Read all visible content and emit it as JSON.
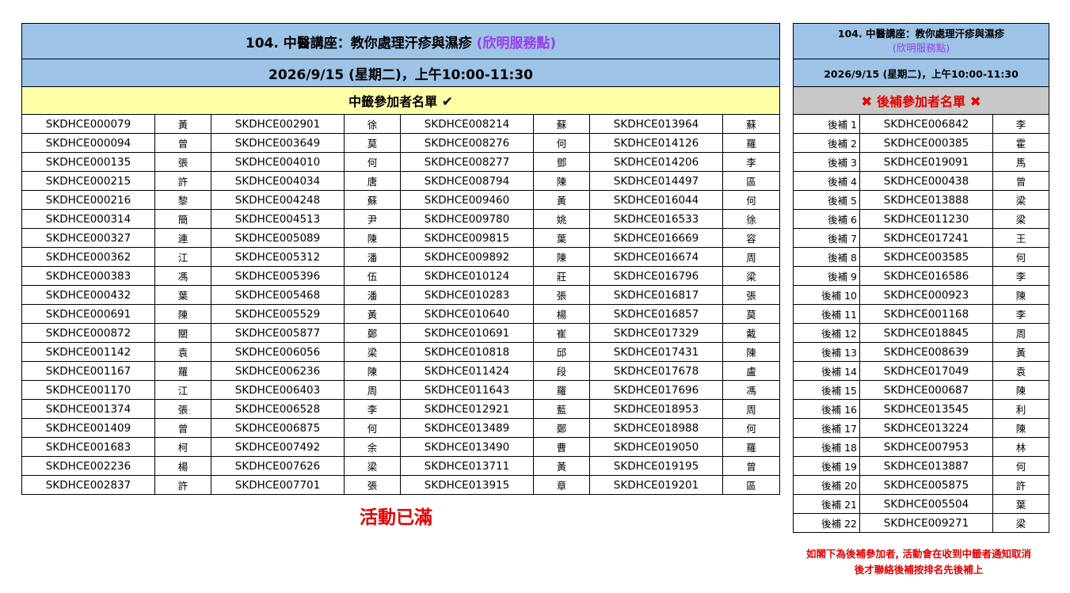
{
  "main": {
    "title_text": "104. 中醫講座：教你處理汗疹與濕疹 ",
    "title_location": "(欣明服務點)",
    "date": "2026/9/15 (星期二)，上午10:00-11:30",
    "selected_header": "中籤參加者名單",
    "check_glyph": "✔",
    "rows": [
      [
        "SKDHCE000079",
        "黃",
        "SKDHCE002901",
        "徐",
        "SKDHCE008214",
        "蘇",
        "SKDHCE013964",
        "蘇"
      ],
      [
        "SKDHCE000094",
        "曾",
        "SKDHCE003649",
        "莫",
        "SKDHCE008276",
        "何",
        "SKDHCE014126",
        "羅"
      ],
      [
        "SKDHCE000135",
        "張",
        "SKDHCE004010",
        "何",
        "SKDHCE008277",
        "鄧",
        "SKDHCE014206",
        "李"
      ],
      [
        "SKDHCE000215",
        "許",
        "SKDHCE004034",
        "唐",
        "SKDHCE008794",
        "陳",
        "SKDHCE014497",
        "區"
      ],
      [
        "SKDHCE000216",
        "黎",
        "SKDHCE004248",
        "蘇",
        "SKDHCE009460",
        "黃",
        "SKDHCE016044",
        "何"
      ],
      [
        "SKDHCE000314",
        "簡",
        "SKDHCE004513",
        "尹",
        "SKDHCE009780",
        "姚",
        "SKDHCE016533",
        "徐"
      ],
      [
        "SKDHCE000327",
        "連",
        "SKDHCE005089",
        "陳",
        "SKDHCE009815",
        "葉",
        "SKDHCE016669",
        "容"
      ],
      [
        "SKDHCE000362",
        "江",
        "SKDHCE005312",
        "潘",
        "SKDHCE009892",
        "陳",
        "SKDHCE016674",
        "周"
      ],
      [
        "SKDHCE000383",
        "馮",
        "SKDHCE005396",
        "伍",
        "SKDHCE010124",
        "莊",
        "SKDHCE016796",
        "梁"
      ],
      [
        "SKDHCE000432",
        "葉",
        "SKDHCE005468",
        "潘",
        "SKDHCE010283",
        "張",
        "SKDHCE016817",
        "張"
      ],
      [
        "SKDHCE000691",
        "陳",
        "SKDHCE005529",
        "黃",
        "SKDHCE010640",
        "楊",
        "SKDHCE016857",
        "莫"
      ],
      [
        "SKDHCE000872",
        "關",
        "SKDHCE005877",
        "鄭",
        "SKDHCE010691",
        "崔",
        "SKDHCE017329",
        "戴"
      ],
      [
        "SKDHCE001142",
        "袁",
        "SKDHCE006056",
        "梁",
        "SKDHCE010818",
        "邱",
        "SKDHCE017431",
        "陳"
      ],
      [
        "SKDHCE001167",
        "羅",
        "SKDHCE006236",
        "陳",
        "SKDHCE011424",
        "段",
        "SKDHCE017678",
        "盧"
      ],
      [
        "SKDHCE001170",
        "江",
        "SKDHCE006403",
        "周",
        "SKDHCE011643",
        "羅",
        "SKDHCE017696",
        "馮"
      ],
      [
        "SKDHCE001374",
        "張",
        "SKDHCE006528",
        "李",
        "SKDHCE012921",
        "藍",
        "SKDHCE018953",
        "周"
      ],
      [
        "SKDHCE001409",
        "曾",
        "SKDHCE006875",
        "何",
        "SKDHCE013489",
        "鄭",
        "SKDHCE018988",
        "何"
      ],
      [
        "SKDHCE001683",
        "柯",
        "SKDHCE007492",
        "余",
        "SKDHCE013490",
        "曹",
        "SKDHCE019050",
        "羅"
      ],
      [
        "SKDHCE002236",
        "楊",
        "SKDHCE007626",
        "梁",
        "SKDHCE013711",
        "黃",
        "SKDHCE019195",
        "曾"
      ],
      [
        "SKDHCE002837",
        "許",
        "SKDHCE007701",
        "張",
        "SKDHCE013915",
        "章",
        "SKDHCE019201",
        "區"
      ]
    ],
    "full_notice": "活動已滿"
  },
  "waitlist": {
    "title_text": "104. 中醫講座：教你處理汗疹與濕疹",
    "title_location": "(欣明服務點)",
    "date": "2026/9/15 (星期二)，上午10:00-11:30",
    "header": "後補參加者名單",
    "x_glyph": "✖",
    "rows": [
      [
        "後補 1",
        "SKDHCE006842",
        "李"
      ],
      [
        "後補 2",
        "SKDHCE000385",
        "霍"
      ],
      [
        "後補 3",
        "SKDHCE019091",
        "馬"
      ],
      [
        "後補 4",
        "SKDHCE000438",
        "曾"
      ],
      [
        "後補 5",
        "SKDHCE013888",
        "梁"
      ],
      [
        "後補 6",
        "SKDHCE011230",
        "梁"
      ],
      [
        "後補 7",
        "SKDHCE017241",
        "王"
      ],
      [
        "後補 8",
        "SKDHCE003585",
        "何"
      ],
      [
        "後補 9",
        "SKDHCE016586",
        "李"
      ],
      [
        "後補 10",
        "SKDHCE000923",
        "陳"
      ],
      [
        "後補 11",
        "SKDHCE001168",
        "李"
      ],
      [
        "後補 12",
        "SKDHCE018845",
        "周"
      ],
      [
        "後補 13",
        "SKDHCE008639",
        "黃"
      ],
      [
        "後補 14",
        "SKDHCE017049",
        "袁"
      ],
      [
        "後補 15",
        "SKDHCE000687",
        "陳"
      ],
      [
        "後補 16",
        "SKDHCE013545",
        "利"
      ],
      [
        "後補 17",
        "SKDHCE013224",
        "陳"
      ],
      [
        "後補 18",
        "SKDHCE007953",
        "林"
      ],
      [
        "後補 19",
        "SKDHCE013887",
        "何"
      ],
      [
        "後補 20",
        "SKDHCE005875",
        "許"
      ],
      [
        "後補 21",
        "SKDHCE005504",
        "葉"
      ],
      [
        "後補 22",
        "SKDHCE009271",
        "梁"
      ]
    ],
    "note_line1": "如閣下為後補參加者, 活動會在收到中籤者通知取消",
    "note_line2": "後才聯絡後補按排名先後補上"
  },
  "colors": {
    "header_blue": "#9dc3e6",
    "selected_yellow": "#ffffa8",
    "waitlist_gray": "#c8c8c8",
    "alert_red": "#e30000",
    "location_purple": "#9b3df0"
  },
  "icons": {
    "check": "check-icon",
    "cross": "x-icon"
  }
}
